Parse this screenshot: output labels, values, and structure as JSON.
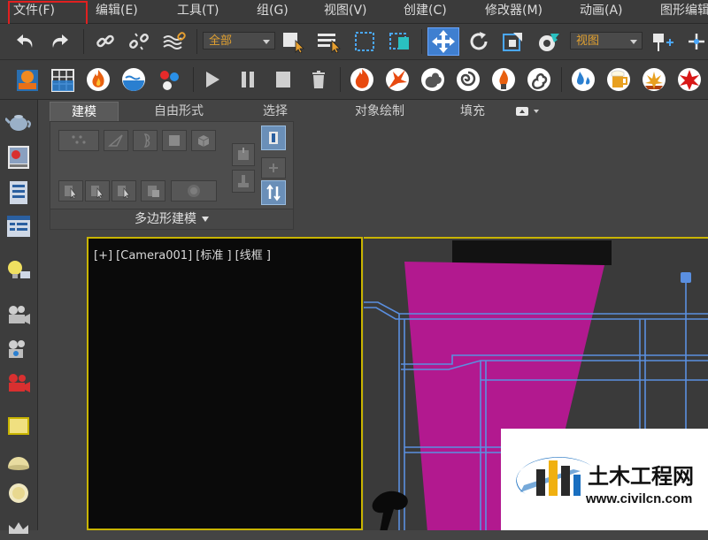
{
  "menubar": {
    "items": [
      "文件(F)",
      "编辑(E)",
      "工具(T)",
      "组(G)",
      "视图(V)",
      "创建(C)",
      "修改器(M)",
      "动画(A)",
      "图形编辑"
    ]
  },
  "toolbar": {
    "selection_filter": "全部",
    "reference_coord": "视图"
  },
  "ribbon": {
    "tabs": [
      "建模",
      "自由形式",
      "选择",
      "对象绘制",
      "填充"
    ],
    "active_tab": "建模",
    "panel_label": "多边形建模"
  },
  "viewport": {
    "label": "[+]  [Camera001]  [标准 ]  [线框 ]"
  },
  "watermark": {
    "title": "土木工程网",
    "url": "www.civilcn.com"
  },
  "colors": {
    "accent_orange": "#e0a030",
    "active_viewport_border": "#c8b400",
    "selection_blue": "#3f7fd0",
    "light_cone_magenta": "#b2198f",
    "wireframe_blue": "#5a8fe0",
    "highlight_red": "#e02020"
  }
}
